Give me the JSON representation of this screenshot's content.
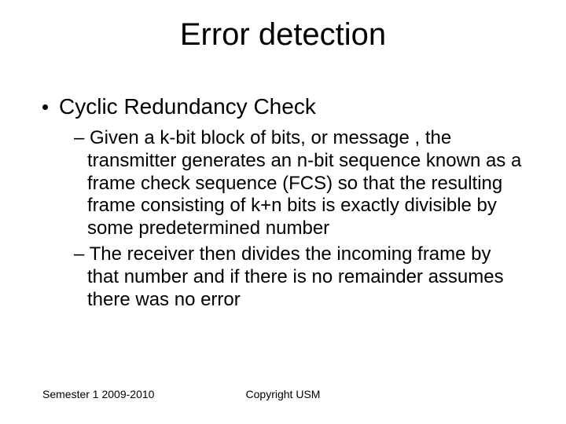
{
  "title": "Error detection",
  "bullets": {
    "l1": "Cyclic Redundancy Check",
    "l2a": "Given a k-bit block of bits, or message , the transmitter generates an n-bit sequence known as a frame check sequence (FCS) so that the resulting frame consisting of k+n bits is exactly divisible by some predetermined number",
    "l2b": "The receiver then divides the incoming frame by that number and if there is no remainder assumes there was no error"
  },
  "footer": {
    "left": "Semester 1 2009-2010",
    "center": "Copyright USM"
  },
  "glyphs": {
    "dash": "– "
  }
}
